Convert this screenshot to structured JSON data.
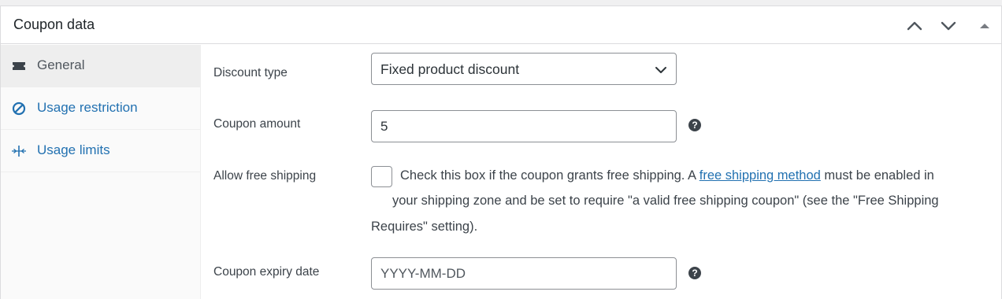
{
  "panel": {
    "title": "Coupon data"
  },
  "tabs": [
    {
      "label": "General",
      "icon": "ticket-icon",
      "active": true
    },
    {
      "label": "Usage restriction",
      "icon": "no-entry-icon",
      "active": false
    },
    {
      "label": "Usage limits",
      "icon": "limits-icon",
      "active": false
    }
  ],
  "fields": {
    "discount_type": {
      "label": "Discount type",
      "value": "Fixed product discount"
    },
    "coupon_amount": {
      "label": "Coupon amount",
      "value": "5",
      "help": "?"
    },
    "free_shipping": {
      "label": "Allow free shipping",
      "checked": false,
      "desc_line1_before": "Check this box if the coupon grants free shipping. A ",
      "desc_link": "free shipping method",
      "desc_line1_after": " must be enabled in",
      "desc_line2": "your shipping zone and be set to require \"a valid free shipping coupon\" (see the \"Free Shipping",
      "desc_line3": "Requires\" setting)."
    },
    "expiry_date": {
      "label": "Coupon expiry date",
      "placeholder": "YYYY-MM-DD",
      "help": "?"
    }
  },
  "colors": {
    "link": "#2271b1",
    "text": "#3c434a",
    "border": "#8c8f94",
    "active_tab_bg": "#eeeeee"
  }
}
